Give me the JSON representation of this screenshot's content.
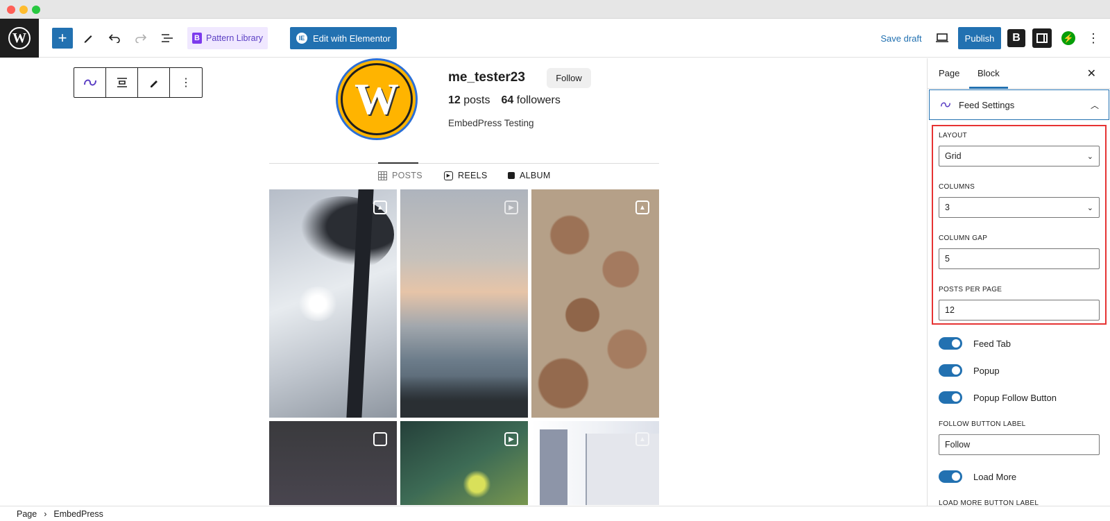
{
  "toolbar": {
    "pattern_library": "Pattern Library",
    "edit_elementor": "Edit with Elementor",
    "save_draft": "Save draft",
    "publish": "Publish",
    "b_icon_letter": "B",
    "elementor_icon_letter": "IE",
    "jetpack_glyph": "⚡"
  },
  "profile": {
    "username": "me_tester23",
    "follow": "Follow",
    "posts_count": "12",
    "posts_word": "posts",
    "followers_count": "64",
    "followers_word": "followers",
    "bio": "EmbedPress Testing",
    "avatar_letter": "W"
  },
  "feed_tabs": {
    "posts": "POSTS",
    "reels": "REELS",
    "album": "ALBUM"
  },
  "sidebar": {
    "tab_page": "Page",
    "tab_block": "Block",
    "panel_title": "Feed Settings",
    "layout_label": "LAYOUT",
    "layout_value": "Grid",
    "columns_label": "COLUMNS",
    "columns_value": "3",
    "column_gap_label": "COLUMN GAP",
    "column_gap_value": "5",
    "posts_per_page_label": "POSTS PER PAGE",
    "posts_per_page_value": "12",
    "toggle_feed_tab": "Feed Tab",
    "toggle_popup": "Popup",
    "toggle_popup_follow": "Popup Follow Button",
    "follow_button_label_label": "FOLLOW BUTTON LABEL",
    "follow_button_label_value": "Follow",
    "toggle_load_more": "Load More",
    "load_more_button_label_label": "LOAD MORE BUTTON LABEL"
  },
  "breadcrumb": {
    "page": "Page",
    "block": "EmbedPress"
  },
  "colors": {
    "accent": "#2271b1",
    "highlight": "#e63333"
  }
}
